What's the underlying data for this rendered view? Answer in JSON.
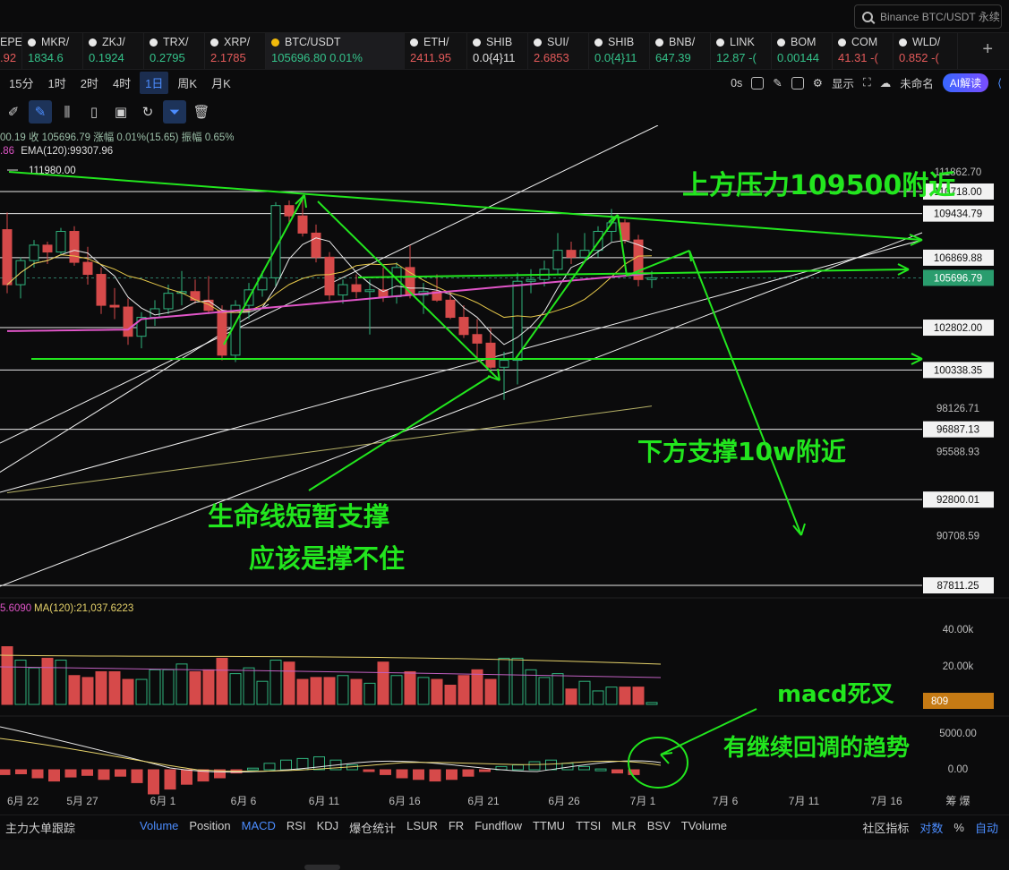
{
  "search": {
    "placeholder": "Binance BTC/USDT 永续"
  },
  "tickers": [
    {
      "symbol": "EPE",
      "value": ".92",
      "dir": "down",
      "w": 25
    },
    {
      "symbol": "MKR/",
      "value": "1834.6",
      "dir": "up",
      "w": 68
    },
    {
      "symbol": "ZKJ/",
      "value": "0.1924",
      "dir": "up",
      "w": 68
    },
    {
      "symbol": "TRX/",
      "value": "0.2795",
      "dir": "up",
      "w": 68
    },
    {
      "symbol": "XRP/",
      "value": "2.1785",
      "dir": "down",
      "w": 68
    },
    {
      "symbol": "BTC/USDT",
      "value": "105696.80  0.01%",
      "dir": "up",
      "w": 155,
      "active": true
    },
    {
      "symbol": "ETH/",
      "value": "2411.95",
      "dir": "down",
      "w": 70
    },
    {
      "symbol": "SHIB",
      "value": "0.0{4}11",
      "dir": "neutral",
      "w": 68
    },
    {
      "symbol": "SUI/",
      "value": "2.6853",
      "dir": "down",
      "w": 68
    },
    {
      "symbol": "SHIB",
      "value": "0.0{4}11",
      "dir": "up",
      "w": 68
    },
    {
      "symbol": "BNB/",
      "value": "647.39",
      "dir": "up",
      "w": 68
    },
    {
      "symbol": "LINK",
      "value": "12.87 -(",
      "dir": "up",
      "w": 68
    },
    {
      "symbol": "BOM",
      "value": "0.00144",
      "dir": "up",
      "w": 68
    },
    {
      "symbol": "COM",
      "value": "41.31 -(",
      "dir": "down",
      "w": 68
    },
    {
      "symbol": "WLD/",
      "value": "0.852 -(",
      "dir": "down",
      "w": 72
    }
  ],
  "timeframes": [
    "15分",
    "1时",
    "2时",
    "4时",
    "1日",
    "周K",
    "月K"
  ],
  "active_timeframe": "1日",
  "toolbar_right": {
    "countdown": "0s",
    "display": "显示",
    "layout_name": "未命名",
    "ai_button": "AI解读"
  },
  "price_header": "00.19  收 105696.79  涨幅 0.01%(15.65)  振幅 0.65%",
  "ema_header": {
    "prefix": ".86",
    "label": "EMA(120):99307.96"
  },
  "max_label": "111980.00",
  "volume_header": {
    "prefix": "5.6090",
    "label": "MA(120):21,037.6223"
  },
  "annotations": {
    "resistance": "上方压力109500附近",
    "support": "下方支撑10w附近",
    "lifeline_1": "生命线短暂支撑",
    "lifeline_2": "应该是撑不住",
    "macd_title": "macd死叉",
    "macd_note": "有继续回调的趋势"
  },
  "price_axis": [
    {
      "price": 111862.7,
      "text": "111862.70",
      "boxed": false
    },
    {
      "price": 110718.0,
      "text": "110718.00",
      "boxed": true
    },
    {
      "price": 109434.79,
      "text": "109434.79",
      "boxed": true
    },
    {
      "price": 106869.88,
      "text": "106869.88",
      "boxed": true
    },
    {
      "price": 105696.79,
      "text": "105696.79",
      "boxed": true,
      "current": true
    },
    {
      "price": 102802.0,
      "text": "102802.00",
      "boxed": true
    },
    {
      "price": 100338.35,
      "text": "100338.35",
      "boxed": true
    },
    {
      "price": 98126.71,
      "text": "98126.71",
      "boxed": false
    },
    {
      "price": 96887.13,
      "text": "96887.13",
      "boxed": true
    },
    {
      "price": 95588.93,
      "text": "95588.93",
      "boxed": false
    },
    {
      "price": 92800.01,
      "text": "92800.01",
      "boxed": true
    },
    {
      "price": 90708.59,
      "text": "90708.59",
      "boxed": false
    },
    {
      "price": 87811.25,
      "text": "87811.25",
      "boxed": true
    }
  ],
  "volume_axis": [
    "40.00k",
    "20.00k",
    "809"
  ],
  "macd_axis": [
    "5000.00",
    "0.00"
  ],
  "date_axis": [
    "6月 22",
    "5月 27",
    "6月 1",
    "6月 6",
    "6月 11",
    "6月 16",
    "6月 21",
    "6月 26",
    "7月 1",
    "7月 6",
    "7月 11",
    "7月 16",
    "筹 爆"
  ],
  "candles": [
    [
      108500,
      109500,
      104800,
      105300
    ],
    [
      105300,
      106900,
      104500,
      106700
    ],
    [
      106700,
      107900,
      106300,
      107600
    ],
    [
      107600,
      107800,
      106500,
      107200
    ],
    [
      107200,
      108600,
      107000,
      108400
    ],
    [
      108400,
      108700,
      106400,
      106600
    ],
    [
      106600,
      107500,
      105300,
      105900
    ],
    [
      105900,
      106300,
      103600,
      104100
    ],
    [
      104100,
      105100,
      103300,
      104000
    ],
    [
      104000,
      104500,
      101800,
      102300
    ],
    [
      102300,
      103700,
      101600,
      103400
    ],
    [
      103400,
      104400,
      102900,
      103900
    ],
    [
      103900,
      105300,
      103600,
      104800
    ],
    [
      104800,
      106100,
      104100,
      104900
    ],
    [
      104900,
      105600,
      104200,
      104400
    ],
    [
      104400,
      105800,
      103600,
      103800
    ],
    [
      103800,
      104100,
      100900,
      101200
    ],
    [
      101200,
      104400,
      100800,
      104100
    ],
    [
      104100,
      105400,
      103300,
      105000
    ],
    [
      105000,
      106100,
      104600,
      105700
    ],
    [
      105700,
      110100,
      105200,
      109900
    ],
    [
      109900,
      110200,
      108800,
      109300
    ],
    [
      109300,
      110500,
      108100,
      108300
    ],
    [
      108300,
      108800,
      106600,
      106900
    ],
    [
      106900,
      107200,
      104400,
      104700
    ],
    [
      104700,
      105600,
      104200,
      105300
    ],
    [
      105300,
      105900,
      104500,
      104900
    ],
    [
      104900,
      105600,
      102400,
      105000
    ],
    [
      105000,
      106300,
      104300,
      104600
    ],
    [
      104600,
      106600,
      104200,
      106300
    ],
    [
      106300,
      107600,
      104500,
      104700
    ],
    [
      104700,
      105400,
      103600,
      104900
    ],
    [
      104900,
      105900,
      104300,
      104400
    ],
    [
      104400,
      104800,
      103300,
      103400
    ],
    [
      103400,
      104100,
      102200,
      102400
    ],
    [
      102400,
      103300,
      100800,
      101900
    ],
    [
      101900,
      102800,
      100400,
      100500
    ],
    [
      100500,
      101400,
      98600,
      100900
    ],
    [
      100900,
      106000,
      99500,
      105500
    ],
    [
      105500,
      106200,
      104800,
      105600
    ],
    [
      105600,
      106700,
      105200,
      106200
    ],
    [
      106200,
      108300,
      105900,
      107300
    ],
    [
      107300,
      107800,
      106500,
      106900
    ],
    [
      106900,
      108300,
      106800,
      107300
    ],
    [
      107300,
      108700,
      106900,
      108400
    ],
    [
      108400,
      109700,
      107800,
      108900
    ],
    [
      108900,
      109100,
      107700,
      107900
    ],
    [
      107900,
      108200,
      105200,
      105600
    ],
    [
      105600,
      106100,
      105100,
      105700
    ]
  ],
  "volumes": [
    30,
    23,
    19,
    24,
    23,
    15,
    14,
    17,
    17,
    13,
    13,
    18,
    18,
    21,
    17,
    18,
    24,
    16,
    19,
    12,
    23,
    22,
    13,
    14,
    14,
    15,
    13,
    11,
    22,
    15,
    17,
    14,
    13,
    10,
    15,
    18,
    13,
    24,
    24,
    18,
    14,
    16,
    8,
    12,
    7,
    9,
    9,
    9,
    1
  ],
  "macd_hist": [
    -300,
    -250,
    -500,
    -700,
    -450,
    -350,
    -600,
    -400,
    -800,
    -1500,
    -1200,
    -900,
    -700,
    -500,
    -200,
    100,
    400,
    600,
    700,
    800,
    600,
    300,
    -100,
    -300,
    -500,
    -600,
    -700,
    -600,
    -400,
    -100,
    200,
    300,
    500,
    600,
    400,
    200,
    50,
    -200,
    -300
  ],
  "chart_data": {
    "type": "candlestick",
    "symbol": "BTC/USDT",
    "interval": "1日",
    "last_close": 105696.79,
    "change": "0.01%(15.65)",
    "amplitude": "0.65%",
    "ema120": 99307.96,
    "volume_ma120": 21037.6223,
    "resistance_level": 109500,
    "support_level": 100000,
    "horizontal_levels": [
      110718.0,
      109434.79,
      106869.88,
      105696.79,
      102802.0,
      100338.35,
      96887.13,
      92800.01,
      87811.25
    ]
  },
  "indicators": [
    "主力大单跟踪",
    "Volume",
    "Position",
    "MACD",
    "RSI",
    "KDJ",
    "爆仓统计",
    "LSUR",
    "FR",
    "Fundflow",
    "TTMU",
    "TTSI",
    "MLR",
    "BSV",
    "TVolume"
  ],
  "active_indicators": [
    "Volume",
    "MACD"
  ],
  "bottom_right": {
    "community": "社区指标",
    "log": "对数",
    "pct": "%",
    "auto": "自动"
  },
  "colors": {
    "up": "#34c28a",
    "down": "#e45a5a",
    "annotation": "#22e61e",
    "ema": "#e055c8",
    "accent": "#4c8dff"
  }
}
